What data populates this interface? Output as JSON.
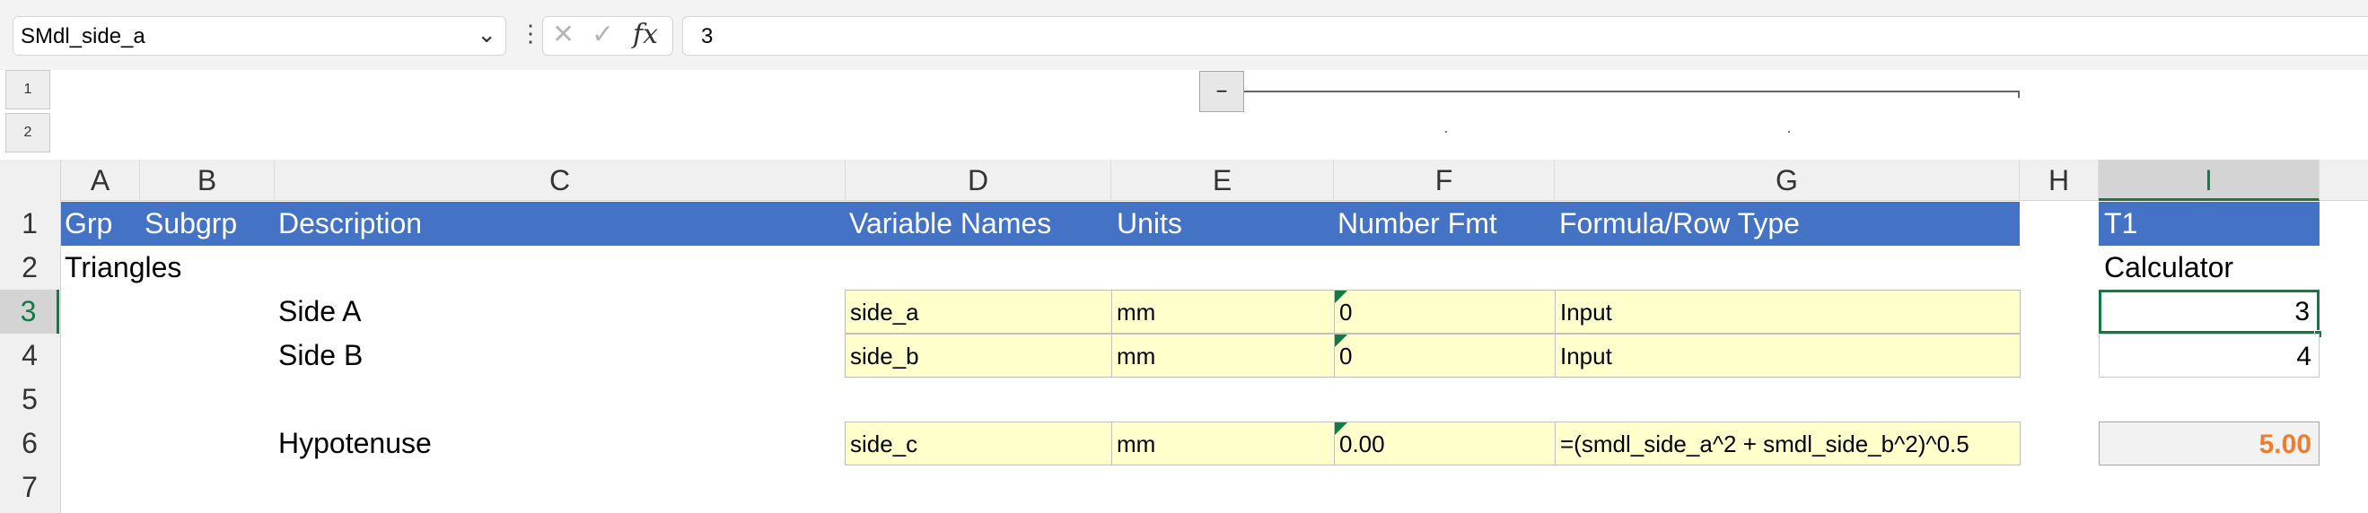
{
  "formula_bar": {
    "name_box": "SMdl_side_a",
    "dots": "⋮",
    "cancel": "✕",
    "enter": "✓",
    "fx": "fx",
    "formula": "3"
  },
  "outline": {
    "levels": [
      "1",
      "2"
    ],
    "collapse": "−"
  },
  "columns": [
    "A",
    "B",
    "C",
    "D",
    "E",
    "F",
    "G",
    "H",
    "I"
  ],
  "rows": [
    "1",
    "2",
    "3",
    "4",
    "5",
    "6",
    "7"
  ],
  "header": {
    "grp": "Grp",
    "subgrp": "Subgrp",
    "description": "Description",
    "variable_names": "Variable Names",
    "units": "Units",
    "number_fmt": "Number Fmt",
    "formula_row_type": "Formula/Row Type",
    "calc_title": "T1"
  },
  "row2": {
    "group": "Triangles",
    "calc_label": "Calculator"
  },
  "rows_data": [
    {
      "description": "Side A",
      "variable": "side_a",
      "units": "mm",
      "fmt": "0",
      "formula": "Input",
      "value": "3"
    },
    {
      "description": "Side B",
      "variable": "side_b",
      "units": "mm",
      "fmt": "0",
      "formula": "Input",
      "value": "4"
    },
    {
      "description": "Hypotenuse",
      "variable": "side_c",
      "units": "mm",
      "fmt": "0.00",
      "formula": "=(smdl_side_a^2 + smdl_side_b^2)^0.5",
      "value": "5.00"
    }
  ],
  "colors": {
    "header_blue": "#4472c4",
    "input_yellow": "#ffffcc",
    "result_orange": "#ed7d31",
    "selection_green": "#107c41"
  }
}
